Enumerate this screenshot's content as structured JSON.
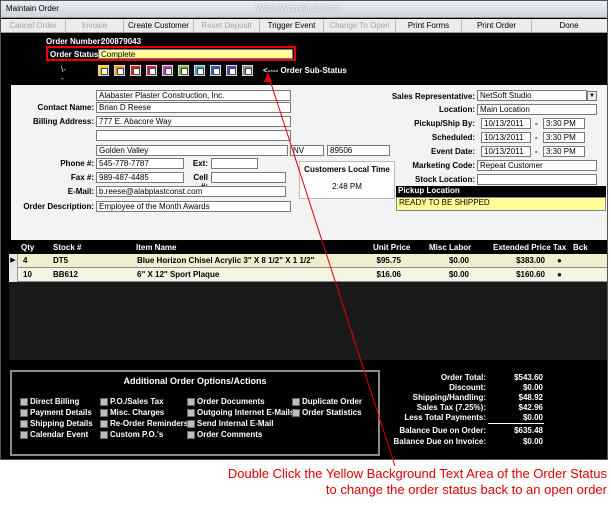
{
  "window": {
    "title": "Maintain Order",
    "center_title": "Work With All Orders"
  },
  "toolbar": {
    "buttons": [
      {
        "label": "Cancel Order",
        "enabled": false
      },
      {
        "label": "Invoice",
        "enabled": false
      },
      {
        "label": "Create Customer",
        "enabled": true
      },
      {
        "label": "Reset Deposit",
        "enabled": false
      },
      {
        "label": "Trigger Event",
        "enabled": true
      },
      {
        "label": "Change To Open",
        "enabled": false
      },
      {
        "label": "Print Forms",
        "enabled": true
      },
      {
        "label": "Print Order",
        "enabled": true
      },
      {
        "label": "Done",
        "enabled": true
      }
    ]
  },
  "order": {
    "number_label": "Order Number:",
    "number": "200879043",
    "status_label": "Order Status:",
    "status": "Complete",
    "substatus_arrow": "\\---------",
    "substatus_label": "<---- Order Sub-Status"
  },
  "customer": {
    "company": "Alabaster Plaster Construction, Inc.",
    "contact_label": "Contact Name:",
    "contact": "Brian D Reese",
    "billing_label": "Billing Address:",
    "address1": "777 E. Abacore Way",
    "address2": "",
    "city": "Golden Valley",
    "state": "NV",
    "zip": "89506",
    "phone_label": "Phone #:",
    "phone": "545-778-7787",
    "ext_label": "Ext:",
    "ext": "",
    "fax_label": "Fax #:",
    "fax": "989-487-4485",
    "cell_label": "Cell #:",
    "cell": "",
    "email_label": "E-Mail:",
    "email": "b.reese@alabplastconst.com",
    "desc_label": "Order Description:",
    "description": "Employee of the Month Awards",
    "local_time_label": "Customers Local Time",
    "local_time": "2:48 PM"
  },
  "right": {
    "sales_rep_label": "Sales Representative:",
    "sales_rep": "NetSoft Studio",
    "location_label": "Location:",
    "location": "Main Location",
    "pickup_label": "Pickup/Ship By:",
    "pickup_date": "10/13/2011",
    "pickup_time": "3:30 PM",
    "scheduled_label": "Scheduled:",
    "scheduled_date": "10/13/2011",
    "scheduled_time": "3:30 PM",
    "event_label": "Event Date:",
    "event_date": "10/13/2011",
    "event_time": "3:30 PM",
    "dash": "-",
    "marketing_label": "Marketing Code:",
    "marketing": "Repeat Customer",
    "stock_label": "Stock Location:",
    "stock": "",
    "pickup_location_label": "Pickup Location",
    "pickup_location": "READY TO BE SHIPPED"
  },
  "grid": {
    "headers": {
      "qty": "Qty",
      "stock": "Stock #",
      "item": "Item Name",
      "unit": "Unit Price",
      "misc": "Misc Labor",
      "ext": "Extended Price",
      "tax": "Tax",
      "bck": "Bck"
    },
    "rows": [
      {
        "qty": "4",
        "stock": "DT5",
        "item": "Blue Horizon Chisel Acrylic 3\" X 8 1/2\" X 1 1/2\"",
        "unit": "$95.75",
        "misc": "$0.00",
        "ext": "$383.00",
        "tax": "●"
      },
      {
        "qty": "10",
        "stock": "BB612",
        "item": "6\" X 12\" Sport Plaque",
        "unit": "$16.06",
        "misc": "$0.00",
        "ext": "$160.60",
        "tax": "●"
      }
    ]
  },
  "options": {
    "title": "Additional Order Options/Actions",
    "col1": [
      "Direct Billing",
      "Payment Details",
      "Shipping Details",
      "Calendar Event"
    ],
    "col2": [
      "P.O./Sales Tax",
      "Misc. Charges",
      "Re-Order Reminders",
      "Custom P.O.'s"
    ],
    "col3": [
      "Order Documents",
      "Outgoing Internet E-Mails",
      "Send Internal E-Mail",
      "Order Comments"
    ],
    "col4": [
      "Duplicate Order",
      "Order Statistics"
    ]
  },
  "totals": {
    "order_total_label": "Order Total:",
    "order_total": "$543.60",
    "discount_label": "Discount:",
    "discount": "$0.00",
    "shipping_label": "Shipping/Handling:",
    "shipping": "$48.92",
    "tax_label": "Sales Tax (7.25%):",
    "tax": "$42.96",
    "payments_label": "Less Total Payments:",
    "payments": "$0.00",
    "balance_order_label": "Balance Due on Order:",
    "balance_order": "$635.48",
    "balance_invoice_label": "Balance Due on Invoice:",
    "balance_invoice": "$0.00"
  },
  "callout": {
    "line1": "Double Click the Yellow Background Text Area of the Order Status",
    "line2": "to change the order status back to an open order",
    "color": "#e00000"
  }
}
